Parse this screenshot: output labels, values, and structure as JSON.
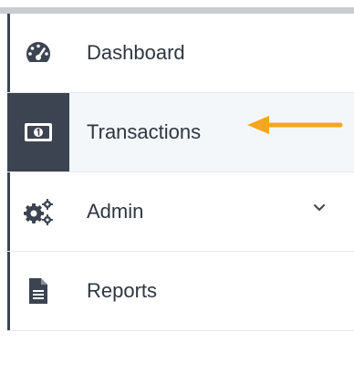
{
  "nav": {
    "items": [
      {
        "id": "dashboard",
        "label": "Dashboard",
        "icon": "dashboard-gauge-icon"
      },
      {
        "id": "transactions",
        "label": "Transactions",
        "icon": "money-bill-icon",
        "active": true
      },
      {
        "id": "admin",
        "label": "Admin",
        "icon": "gears-icon",
        "expandable": true
      },
      {
        "id": "reports",
        "label": "Reports",
        "icon": "document-icon"
      }
    ]
  },
  "colors": {
    "sidebar_dark": "#3c4451",
    "active_background": "#f4f7fa",
    "arrow": "#f5a623",
    "text": "#2f3640",
    "top_bar": "#c9ccd1"
  }
}
